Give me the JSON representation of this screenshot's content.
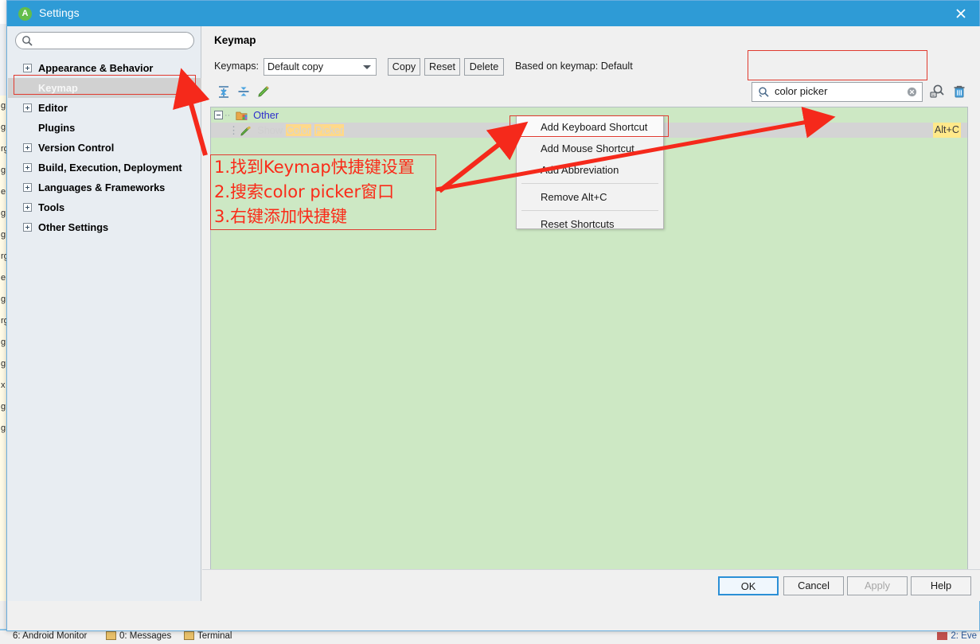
{
  "window": {
    "title": "Settings",
    "app_icon": "android-studio-icon",
    "close_label": "✕",
    "titlebar_color": "#2e9bd6"
  },
  "sidebar": {
    "search_placeholder": "",
    "search_value": "",
    "items": [
      {
        "label": "Appearance & Behavior",
        "expandable": true,
        "selected": false
      },
      {
        "label": "Keymap",
        "expandable": false,
        "selected": true
      },
      {
        "label": "Editor",
        "expandable": true,
        "selected": false
      },
      {
        "label": "Plugins",
        "expandable": false,
        "selected": false
      },
      {
        "label": "Version Control",
        "expandable": true,
        "selected": false
      },
      {
        "label": "Build, Execution, Deployment",
        "expandable": true,
        "selected": false
      },
      {
        "label": "Languages & Frameworks",
        "expandable": true,
        "selected": false
      },
      {
        "label": "Tools",
        "expandable": true,
        "selected": false
      },
      {
        "label": "Other Settings",
        "expandable": true,
        "selected": false
      }
    ]
  },
  "main": {
    "page_title": "Keymap",
    "keymaps_label": "Keymaps:",
    "keymaps_value": "Default copy",
    "buttons": {
      "copy": "Copy",
      "reset": "Reset",
      "delete": "Delete"
    },
    "based_on": "Based on keymap: Default",
    "toolbar": [
      {
        "name": "expand-all-icon"
      },
      {
        "name": "collapse-all-icon"
      },
      {
        "name": "edit-shortcut-icon"
      }
    ],
    "filter": {
      "value": "color picker",
      "clear_label": "⊗",
      "find_by_shortcut_icon": "find-by-shortcut-icon",
      "clear_filter_icon": "trash-icon"
    },
    "tree": {
      "group_label": "Other",
      "action_prefix": "Show ",
      "action_highlight_1": "Color",
      "action_highlight_2": "Picker",
      "shortcut": "Alt+C"
    }
  },
  "context_menu": {
    "items": [
      {
        "label": "Add Keyboard Shortcut",
        "separator_after": false
      },
      {
        "label": "Add Mouse Shortcut",
        "separator_after": false
      },
      {
        "label": "Add Abbreviation",
        "separator_after": true
      },
      {
        "label": "Remove Alt+C",
        "separator_after": true
      },
      {
        "label": "Reset Shortcuts",
        "separator_after": false
      }
    ]
  },
  "annotation": {
    "lines": [
      "1.找到Keymap快捷键设置",
      "2.搜索color picker窗口",
      "3.右键添加快捷键"
    ],
    "color": "#fa2a18"
  },
  "dialog_buttons": {
    "ok": "OK",
    "cancel": "Cancel",
    "apply": "Apply",
    "help": "Help"
  },
  "ide_status_bar": {
    "items": [
      {
        "label": "6: Android Monitor",
        "has_icon": false
      },
      {
        "label": "0: Messages",
        "has_icon": true
      },
      {
        "label": "Terminal",
        "has_icon": true
      }
    ],
    "right_label": "2: Eve"
  },
  "ide_background": {
    "log_fragments": [
      "g",
      "g",
      "rg",
      "g",
      "e",
      "g",
      "g",
      "rg",
      "e",
      "g",
      "rg",
      "g",
      "g",
      "x",
      "g",
      "g"
    ]
  },
  "colors": {
    "accent": "#2e9bd6",
    "tree_bg": "#cde8c4",
    "annotation_red": "#fa2a18",
    "highlight_yellow": "#ffd98a"
  }
}
